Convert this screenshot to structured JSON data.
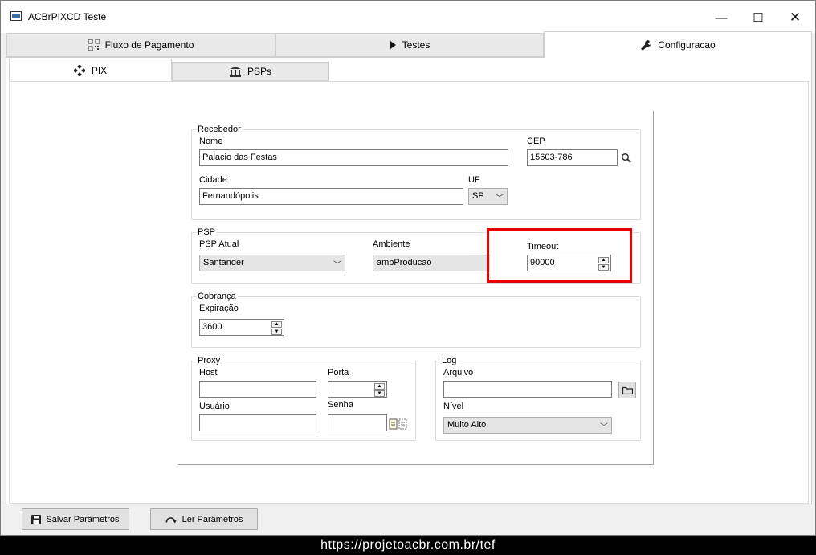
{
  "window": {
    "title": "ACBrPIXCD Teste",
    "minimize_glyph": "—",
    "maximize_glyph": "☐",
    "close_glyph": "✕"
  },
  "main_tabs": [
    {
      "label": "Fluxo de Pagamento",
      "icon": "qr-code-icon"
    },
    {
      "label": "Testes",
      "icon": "play-icon"
    },
    {
      "label": "Configuracao",
      "icon": "wrench-icon",
      "active": true
    }
  ],
  "sub_tabs": [
    {
      "label": "PIX",
      "icon": "pix-diamond-icon",
      "active": true
    },
    {
      "label": "PSPs",
      "icon": "bank-icon"
    }
  ],
  "recebedor": {
    "group_label": "Recebedor",
    "nome_label": "Nome",
    "nome_value": "Palacio das Festas",
    "cep_label": "CEP",
    "cep_value": "15603-786",
    "cidade_label": "Cidade",
    "cidade_value": "Fernandópolis",
    "uf_label": "UF",
    "uf_value": "SP"
  },
  "psp": {
    "group_label": "PSP",
    "psp_atual_label": "PSP Atual",
    "psp_atual_value": "Santander",
    "ambiente_label": "Ambiente",
    "ambiente_value": "ambProducao",
    "timeout_label": "Timeout",
    "timeout_value": "90000"
  },
  "cobranca": {
    "group_label": "Cobrança",
    "expiracao_label": "Expiração",
    "expiracao_value": "3600"
  },
  "proxy": {
    "group_label": "Proxy",
    "host_label": "Host",
    "host_value": "",
    "porta_label": "Porta",
    "porta_value": "",
    "usuario_label": "Usuário",
    "usuario_value": "",
    "senha_label": "Senha",
    "senha_value": ""
  },
  "log": {
    "group_label": "Log",
    "arquivo_label": "Arquivo",
    "arquivo_value": "",
    "nivel_label": "Nível",
    "nivel_value": "Muito Alto"
  },
  "footer": {
    "salvar_label": "Salvar Parâmetros",
    "ler_label": "Ler Parâmetros"
  },
  "overlay": {
    "url_text": "https://projetoacbr.com.br/tef"
  },
  "colors": {
    "highlight": "#e60000",
    "window_bg": "#f0f0f0"
  }
}
